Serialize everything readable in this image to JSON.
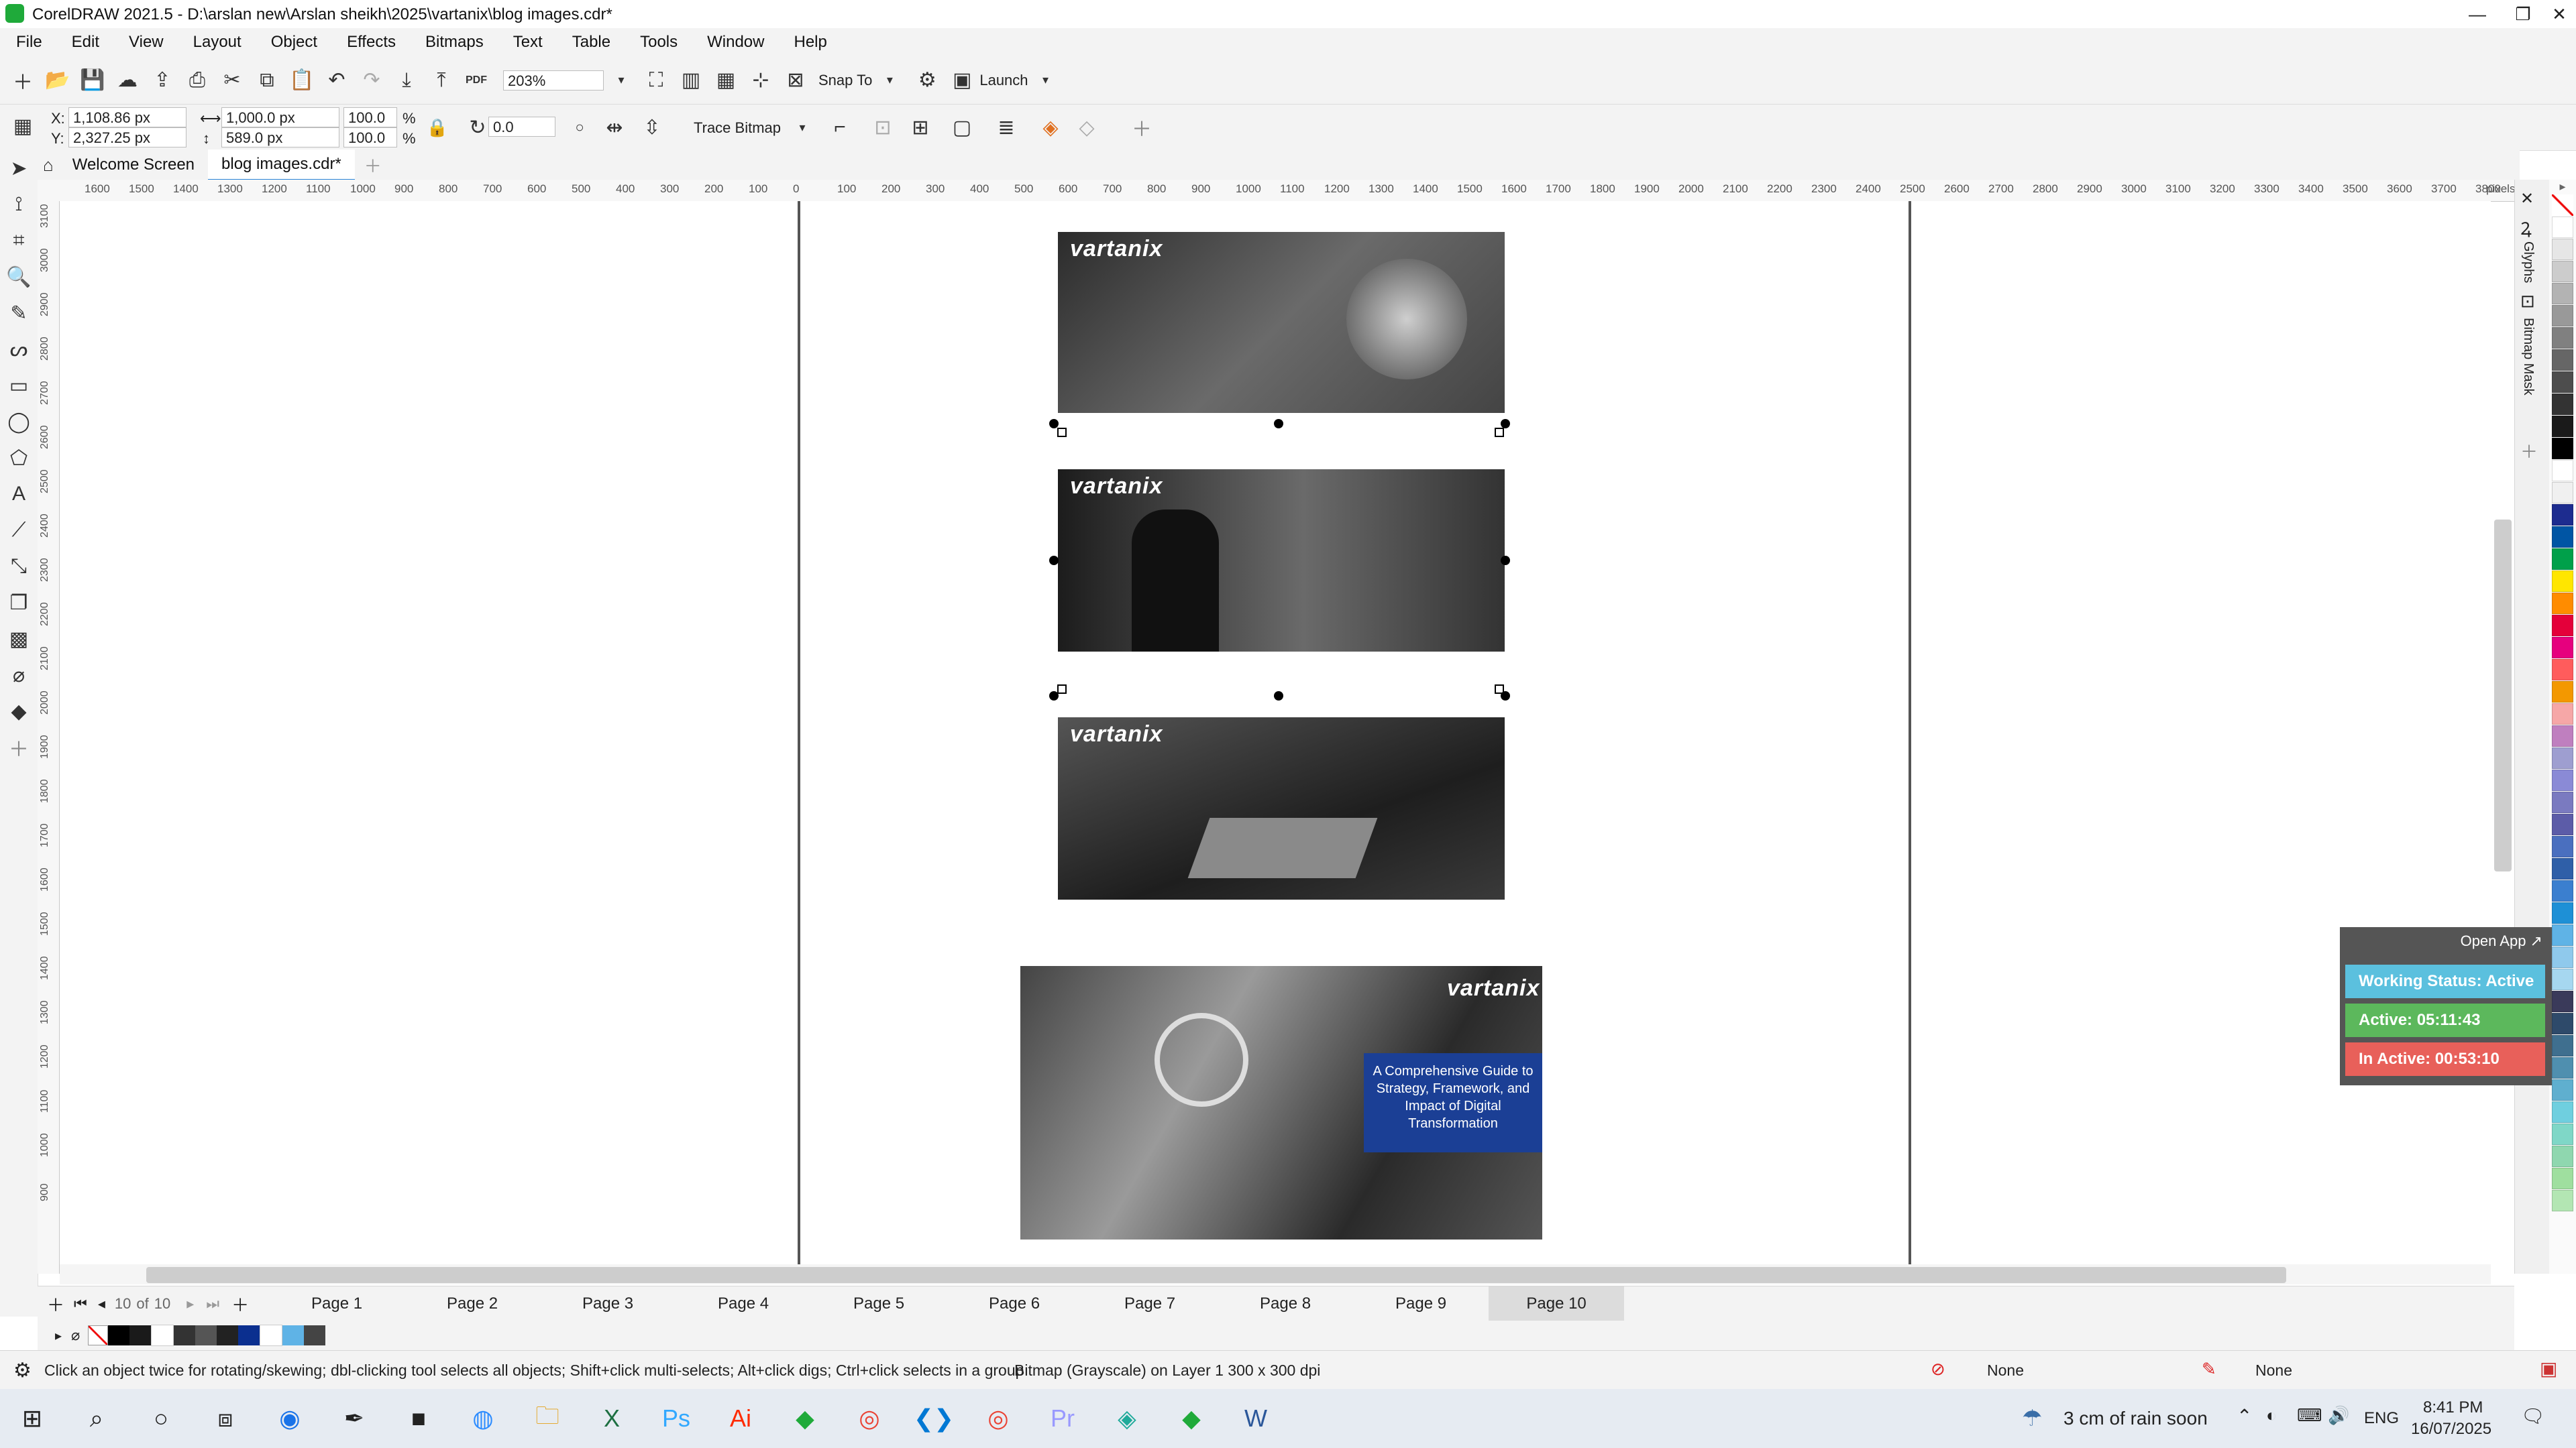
{
  "window": {
    "title": "CorelDRAW 2021.5 - D:\\arslan new\\Arslan sheikh\\2025\\vartanix\\blog images.cdr*",
    "minimize": "—",
    "maximize": "❐",
    "close": "✕"
  },
  "menu": [
    "File",
    "Edit",
    "View",
    "Layout",
    "Object",
    "Effects",
    "Bitmaps",
    "Text",
    "Table",
    "Tools",
    "Window",
    "Help"
  ],
  "standard_toolbar": {
    "zoom": "203%",
    "pdf_label": "PDF",
    "snap_to": "Snap To",
    "launch": "Launch"
  },
  "property_bar": {
    "x_label": "X:",
    "x_value": "1,108.86 px",
    "y_label": "Y:",
    "y_value": "2,327.25 px",
    "width_value": "1,000.0 px",
    "height_value": "589.0 px",
    "scale_w": "100.0",
    "scale_h": "100.0",
    "percent": "%",
    "rotation": "0.0",
    "trace_bitmap": "Trace Bitmap"
  },
  "doc_tabs": {
    "welcome": "Welcome Screen",
    "active": "blog images.cdr*"
  },
  "ruler": {
    "h_ticks": [
      "1600",
      "1500",
      "1400",
      "1300",
      "1200",
      "1100",
      "1000",
      "900",
      "800",
      "700",
      "600",
      "500",
      "400",
      "300",
      "200",
      "100",
      "0",
      "100",
      "200",
      "300",
      "400",
      "500",
      "600",
      "700",
      "800",
      "900",
      "1000",
      "1100",
      "1200",
      "1300",
      "1400",
      "1500",
      "1600",
      "1700",
      "1800",
      "1900",
      "2000",
      "2100",
      "2200",
      "2300",
      "2400",
      "2500",
      "2600",
      "2700",
      "2800",
      "2900",
      "3000",
      "3100",
      "3200",
      "3300",
      "3400",
      "3500",
      "3600",
      "3700",
      "3800"
    ],
    "unit": "pixels",
    "v_ticks": [
      "3100",
      "3000",
      "2900",
      "2800",
      "2700",
      "2600",
      "2500",
      "2400",
      "2300",
      "2200",
      "2100",
      "2000",
      "1900",
      "1800",
      "1700",
      "1600",
      "1500",
      "1400",
      "1300",
      "1200",
      "1100",
      "1000",
      "900"
    ]
  },
  "canvas": {
    "logo_text": "vartanix",
    "banner_text": "A Comprehensive Guide to Strategy, Framework, and Impact of Digital Transformation"
  },
  "docker": {
    "tab1": "Glyphs",
    "tab2": "Bitmap Mask"
  },
  "palette_colors": [
    "#ffffff",
    "#e6e6e6",
    "#cccccc",
    "#b3b3b3",
    "#999999",
    "#808080",
    "#666666",
    "#4d4d4d",
    "#333333",
    "#1a1a1a",
    "#000000",
    "#ffffff",
    "#f0f0f0",
    "#1d2c8f",
    "#0055a4",
    "#00a04a",
    "#ffe600",
    "#ff8c00",
    "#e4003a",
    "#e6007e",
    "#ff5c5c",
    "#f39800",
    "#f6a7a7",
    "#bf7fbf",
    "#9e9ed0",
    "#8a8ad6",
    "#7a7ac0",
    "#5c5ca8",
    "#4a6fbf",
    "#2f5fa8",
    "#3b7fcf",
    "#1e90d6",
    "#5fb3e6",
    "#8fc9ec",
    "#a6d7f0",
    "#3a3a5a",
    "#2e4a6a",
    "#3f6f8f",
    "#4f8faf",
    "#5fafcf",
    "#6fcfdf",
    "#7fd7c7",
    "#8fd7af",
    "#9fdf9f",
    "#b3e6b3"
  ],
  "page_nav": {
    "counter": "10",
    "of": "of",
    "total": "10",
    "pages": [
      "Page 1",
      "Page 2",
      "Page 3",
      "Page 4",
      "Page 5",
      "Page 6",
      "Page 7",
      "Page 8",
      "Page 9",
      "Page 10"
    ],
    "active_index": 9
  },
  "status": {
    "hint": "Click an object twice for rotating/skewing; dbl-clicking tool selects all objects; Shift+click multi-selects; Alt+click digs; Ctrl+click selects in a group",
    "info": "Bitmap (Grayscale) on Layer 1 300 x 300 dpi",
    "fill": "None",
    "outline": "None"
  },
  "tracker": {
    "open_app": "Open App ↗",
    "working": "Working Status: Active",
    "active": "Active: 05:11:43",
    "inactive": "In Active: 00:53:10",
    "colors": {
      "working": "#5bc0de",
      "active": "#5cb85c",
      "inactive": "#e8605a"
    }
  },
  "taskbar": {
    "weather": "3 cm of rain soon",
    "lang": "ENG",
    "time": "8:41 PM",
    "date": "16/07/2025"
  }
}
